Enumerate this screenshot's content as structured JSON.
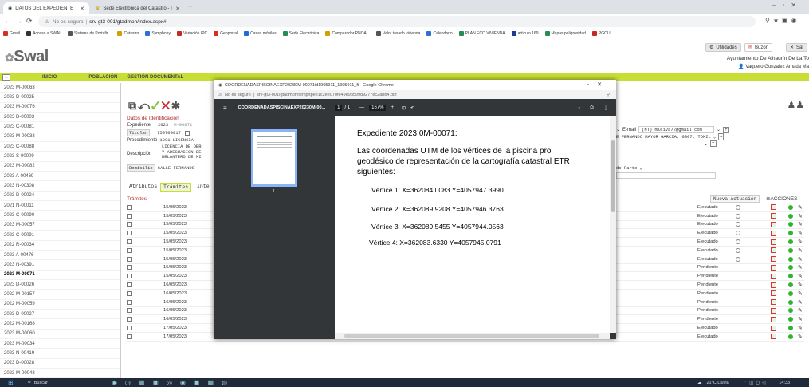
{
  "browser": {
    "tabs": [
      {
        "label": "DATOS DEL EXPEDIENTE",
        "active": true
      },
      {
        "label": "Sede Electrónica del Catastro - I",
        "active": false
      }
    ],
    "url_prefix": "No es seguro",
    "url": "srv-gt3-001/gtadmon/index.aspx#",
    "bookmarks": [
      "Gmail",
      "Acceso a SWAL",
      "Sistema de Portafir...",
      "Catastro",
      "Symphony",
      "Variación IPC",
      "Geoportal",
      "Casas móviles",
      "Sede Electrónica",
      "Comparador PNOA...",
      "Valor tasado vivienda",
      "Calendario",
      "PLAN ECO VIVIENDA",
      "articulo 169",
      "Mapas peligrosidad",
      "PGOU"
    ]
  },
  "app": {
    "logo": "Swal",
    "header_buttons": [
      "Utilidades",
      "Buzón",
      "Sal"
    ],
    "ayuntamiento": "Ayuntamiento De Alhaurín De La To",
    "user": "Vaquero Gonzalez Amada Ma",
    "nav": [
      "INICIO",
      "POBLACIÓN",
      "GESTIÓN DOCUMENTAL"
    ]
  },
  "sidebar": {
    "items": [
      "2023 M-00063",
      "2023 D-00025",
      "2023 M-00076",
      "2023 D-00003",
      "2023 C-00081",
      "2023 M-00033",
      "2023 C-00088",
      "2023 S-00009",
      "2023 M-00082",
      "2023 A-00469",
      "2023 N-00308",
      "2023 D-00024",
      "2021 N-00011",
      "2023 C-00090",
      "2023 M-00057",
      "2023 C-00091",
      "2022 R-00034",
      "2023 A-00476",
      "2023 N-00391",
      "2023 M-00071",
      "2023 D-00026",
      "2022 M-00157",
      "2022 M-00059",
      "2023 D-00027",
      "2022 M-00168",
      "2023 M-00060",
      "2023 M-00034",
      "2023 N-00419",
      "2023 D-00028",
      "2023 M-00048"
    ],
    "selected": "2023 M-00071"
  },
  "main": {
    "section_title": "Datos de Identificación",
    "expediente_label": "Expediente",
    "expediente_year": "2023",
    "expediente_code": "M-00071",
    "titular_label": "Titular",
    "titular_value": "75070091T",
    "procedimiento_label": "Procedimiento",
    "procedimiento_code": "1001",
    "procedimiento_value": "LICENCIA",
    "descripcion_label": "Descripción",
    "descripcion_lines": [
      "LICENCIA DE OBR",
      "Y ADECUACION DE",
      "DELANTERO DE MI"
    ],
    "domicilio_label": "Domicilio",
    "domicilio_value": "CALLE FERNANDO",
    "email_label": "E-mail",
    "email_value": "(NT) mleiva72@gmail.com",
    "address_right": "E FERNANDO MAYOR GARCIA, 0007, TOMIL",
    "de_parte": "de Parte",
    "subtabs": [
      "Atributos",
      "Trámites",
      "Inte"
    ],
    "tramites_title": "Trámites",
    "nueva_actuacion": "Nueva Actuación",
    "acciones": "ACCIONES"
  },
  "table": {
    "rows": [
      {
        "date": "15/05/2023",
        "status": "Ejecutado",
        "icon": true
      },
      {
        "date": "15/05/2023",
        "status": "Ejecutado",
        "icon": true
      },
      {
        "date": "15/05/2023",
        "status": "Ejecutado",
        "icon": true
      },
      {
        "date": "15/05/2023",
        "status": "Ejecutado",
        "icon": true
      },
      {
        "date": "15/05/2023",
        "status": "Ejecutado",
        "icon": true
      },
      {
        "date": "15/05/2023",
        "status": "Ejecutado",
        "icon": true
      },
      {
        "date": "15/05/2023",
        "status": "Ejecutado",
        "icon": true
      },
      {
        "date": "15/05/2023",
        "status": "Pendiente",
        "icon": false
      },
      {
        "date": "15/05/2023",
        "status": "Pendiente",
        "icon": false
      },
      {
        "date": "16/05/2023",
        "status": "Pendiente",
        "icon": false
      },
      {
        "date": "16/05/2023",
        "status": "Pendiente",
        "icon": false
      },
      {
        "date": "16/05/2023",
        "status": "Pendiente",
        "icon": false
      },
      {
        "date": "16/05/2023",
        "status": "Pendiente",
        "icon": false
      },
      {
        "date": "16/05/2023",
        "status": "Pendiente",
        "icon": false
      },
      {
        "date": "17/05/2023",
        "status": "Ejecutado",
        "icon": false
      },
      {
        "date": "17/05/2023",
        "status": "Ejecutado",
        "icon": false
      }
    ]
  },
  "pdf": {
    "window_title": "COORDENADASPISCINAEXP20230M-00071id1905911_1905911_fi - Google Chrome",
    "url_prefix": "No es seguro",
    "url": "srv-gt3-001/gtadmon/temp/tpee1c2ee070fe49e9b599d9277ec2abb4.pdf",
    "doc_title": "COORDENADASPISCINAEXP20230M-00...",
    "page": "1",
    "pages": "/ 1",
    "zoom": "167%",
    "thumb_number": "1",
    "heading": "Expediente 2023 0M-00071:",
    "para_lines": [
      "Las coordenadas UTM de los vértices de la piscina pro",
      "geodésico de representación de la cartografía catastral ETR",
      "siguientes:"
    ],
    "vertices": [
      "Vértice 1: X=362084.0083  Y=4057947.3990",
      "Vértice 2: X=362089.9208  Y=4057946.3763",
      "Vértice 3: X=362089.5455  Y=4057944.0563",
      "Vértice 4: X=362083.6330  Y=4057945.0791"
    ]
  },
  "taskbar": {
    "search": "Buscar",
    "weather": "21°C Lluvia",
    "time": "14:33"
  }
}
